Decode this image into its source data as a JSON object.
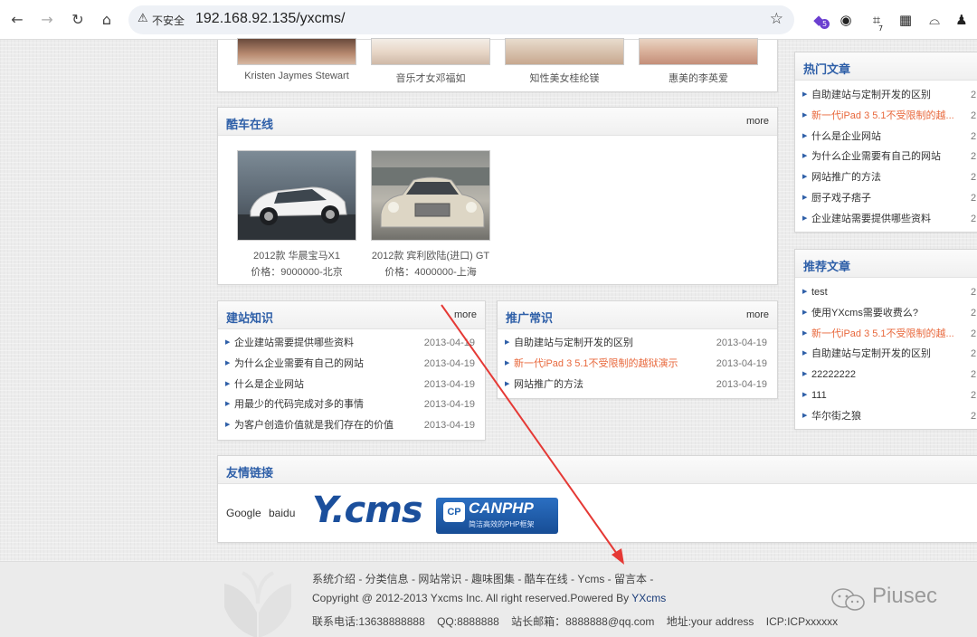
{
  "browser": {
    "security_icon": "warning-triangle-icon",
    "security_label": "不安全",
    "url": "192.168.92.135/yxcms/",
    "ext_badge": "5",
    "ext_counter": "7"
  },
  "top_gallery": {
    "captions": [
      "Kristen Jaymes Stewart",
      "音乐才女邓福如",
      "知性美女桂纶镁",
      "惠美的李英爱"
    ]
  },
  "cars": {
    "title": "酷车在线",
    "more": "more",
    "items": [
      {
        "name": "2012款 华晨宝马X1",
        "price": "价格：9000000-北京"
      },
      {
        "name": "2012款 宾利欧陆(进口) GT",
        "price": "价格：4000000-上海"
      }
    ]
  },
  "build_knowledge": {
    "title": "建站知识",
    "more": "more",
    "items": [
      {
        "text": "企业建站需要提供哪些资料",
        "date": "2013-04-19"
      },
      {
        "text": "为什么企业需要有自己的网站",
        "date": "2013-04-19"
      },
      {
        "text": "什么是企业网站",
        "date": "2013-04-19"
      },
      {
        "text": "用最少的代码完成对多的事情",
        "date": "2013-04-19"
      },
      {
        "text": "为客户创造价值就是我们存在的价值",
        "date": "2013-04-19"
      }
    ]
  },
  "promo_tips": {
    "title": "推广常识",
    "more": "more",
    "items": [
      {
        "text": "自助建站与定制开发的区别",
        "date": "2013-04-19",
        "highlight": false
      },
      {
        "text": "新一代iPad 3 5.1不受限制的越狱演示",
        "date": "2013-04-19",
        "highlight": true
      },
      {
        "text": "网站推广的方法",
        "date": "2013-04-19",
        "highlight": false
      }
    ]
  },
  "friend_links": {
    "title": "友情链接",
    "links": [
      "Google",
      "baidu"
    ],
    "logo1": "Y.cms",
    "logo2": "CANPHP",
    "logo2_sub": "简洁高效的PHP框架"
  },
  "hot_articles": {
    "title": "热门文章",
    "items": [
      {
        "text": "自助建站与定制开发的区别",
        "date": "2",
        "highlight": false
      },
      {
        "text": "新一代iPad 3 5.1不受限制的越...",
        "date": "2",
        "highlight": true
      },
      {
        "text": "什么是企业网站",
        "date": "2",
        "highlight": false
      },
      {
        "text": "为什么企业需要有自己的网站",
        "date": "2",
        "highlight": false
      },
      {
        "text": "网站推广的方法",
        "date": "2",
        "highlight": false
      },
      {
        "text": "厨子戏子痞子",
        "date": "2",
        "highlight": false
      },
      {
        "text": "企业建站需要提供哪些资料",
        "date": "2",
        "highlight": false
      }
    ]
  },
  "recommended": {
    "title": "推荐文章",
    "items": [
      {
        "text": "test",
        "date": "2",
        "highlight": false
      },
      {
        "text": "使用YXcms需要收费么?",
        "date": "2",
        "highlight": false
      },
      {
        "text": "新一代iPad 3 5.1不受限制的越...",
        "date": "2",
        "highlight": true
      },
      {
        "text": "自助建站与定制开发的区别",
        "date": "2",
        "highlight": false
      },
      {
        "text": "22222222",
        "date": "2",
        "highlight": false
      },
      {
        "text": "111",
        "date": "2",
        "highlight": false
      },
      {
        "text": "华尔街之狼",
        "date": "2",
        "highlight": false
      }
    ]
  },
  "footer": {
    "nav": "系统介绍 - 分类信息 - 网站常识 - 趣味图集 - 酷车在线 - Ycms - 留言本 -",
    "copyright": "Copyright @ 2012-2013 Yxcms Inc. All right reserved.Powered By",
    "powered_by": "YXcms",
    "contact": "联系电话:13638888888    QQ:8888888    站长邮箱：8888888@qq.com    地址:your address    ICP:ICPxxxxxx"
  },
  "watermark": "Piusec",
  "colors": {
    "title_blue": "#2e5fa8",
    "highlight_orange": "#e8683c",
    "annotation_red": "#e53935"
  }
}
